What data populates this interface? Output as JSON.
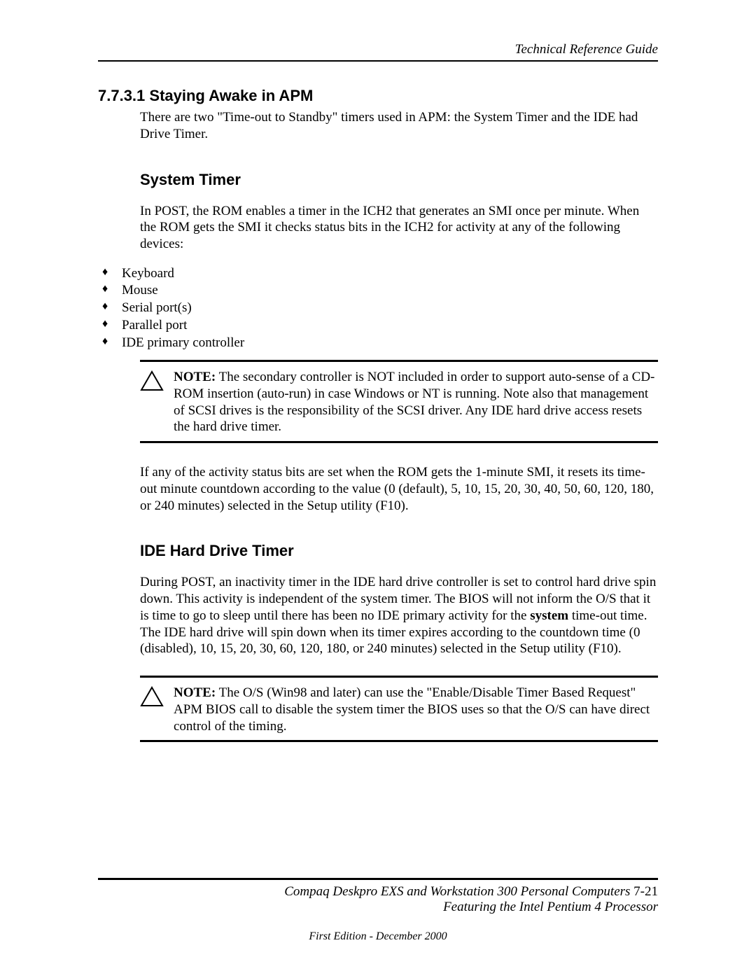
{
  "header": {
    "doc_title": "Technical Reference Guide"
  },
  "section": {
    "number": "7.7.3.1",
    "title": "Staying Awake in APM",
    "intro": "There are two \"Time-out to Standby\" timers used in APM: the System Timer and the IDE had Drive Timer."
  },
  "system_timer": {
    "heading": "System Timer",
    "para1": "In POST, the ROM enables a timer in the ICH2 that generates an SMI once per minute. When the ROM gets the SMI it checks status bits in the ICH2 for activity at any of the following devices:",
    "devices": [
      "Keyboard",
      "Mouse",
      "Serial port(s)",
      "Parallel port",
      "IDE primary controller"
    ],
    "note_label": "NOTE:",
    "note_body": " The secondary controller is NOT included in order to support auto-sense of a CD-ROM insertion (auto-run) in case Windows or NT is running. Note also that management of SCSI drives is the responsibility of the SCSI driver. Any IDE hard drive access resets the hard drive timer.",
    "para2": "If any of the activity status bits are set when the ROM gets the 1-minute SMI, it resets its time-out minute countdown according to the value (0 (default), 5, 10, 15, 20, 30, 40, 50, 60, 120, 180, or 240 minutes) selected in the Setup utility (F10)."
  },
  "ide_timer": {
    "heading": "IDE Hard Drive Timer",
    "para_pre": "During POST, an inactivity timer in the IDE hard drive controller is set to control hard drive spin down. This activity is independent of the system timer. The BIOS will not inform the O/S that it is time to go to sleep until there has been no IDE primary activity for the ",
    "bold_word": "system",
    "para_post": " time-out time. The IDE hard drive will spin down when its timer expires according to the countdown time (0 (disabled), 10, 15, 20, 30, 60, 120, 180, or 240 minutes) selected in the Setup utility (F10).",
    "note_label": "NOTE:",
    "note_body": " The O/S (Win98 and later) can use the \"Enable/Disable Timer Based Request\" APM BIOS call to disable the system timer the BIOS uses so that the O/S can have direct control of the timing."
  },
  "footer": {
    "line1_italic": "Compaq Deskpro EXS and Workstation 300 Personal Computers",
    "page_label": "  7-21",
    "line2": "Featuring the Intel Pentium 4 Processor",
    "edition": "First Edition - December 2000"
  }
}
